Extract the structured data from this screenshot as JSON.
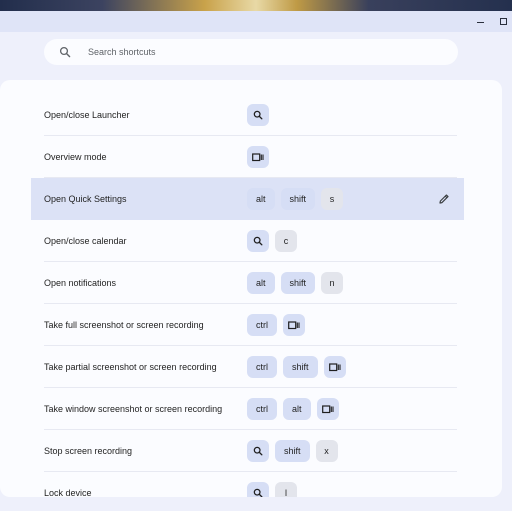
{
  "colors": {
    "window_bg": "#eef0fb",
    "titlebar_bg": "#dfe4f7",
    "panel_bg": "#fbfcff",
    "selected_row_bg": "#dce2f6",
    "key_bg": "#d6def5",
    "char_key_bg": "#e3e5ec"
  },
  "search": {
    "placeholder": "Search shortcuts",
    "icon": "search-icon"
  },
  "window_controls": [
    {
      "name": "minimize",
      "icon": "minimize-icon"
    },
    {
      "name": "maximize",
      "icon": "maximize-icon"
    }
  ],
  "shortcuts": [
    {
      "description": "Open/close Launcher",
      "keys": [
        {
          "type": "icon",
          "icon": "search"
        }
      ]
    },
    {
      "description": "Overview mode",
      "keys": [
        {
          "type": "icon",
          "icon": "overview"
        }
      ]
    },
    {
      "description": "Open Quick Settings",
      "selected": true,
      "edit_icon": "pencil-icon",
      "keys": [
        {
          "type": "mod",
          "label": "alt"
        },
        {
          "type": "mod",
          "label": "shift"
        },
        {
          "type": "text",
          "label": "s"
        }
      ]
    },
    {
      "description": "Open/close calendar",
      "keys": [
        {
          "type": "icon",
          "icon": "search"
        },
        {
          "type": "text",
          "label": "c"
        }
      ]
    },
    {
      "description": "Open notifications",
      "keys": [
        {
          "type": "mod",
          "label": "alt"
        },
        {
          "type": "mod",
          "label": "shift"
        },
        {
          "type": "text",
          "label": "n"
        }
      ]
    },
    {
      "description": "Take full screenshot or screen recording",
      "keys": [
        {
          "type": "mod",
          "label": "ctrl"
        },
        {
          "type": "icon",
          "icon": "overview"
        }
      ]
    },
    {
      "description": "Take partial screenshot or screen recording",
      "keys": [
        {
          "type": "mod",
          "label": "ctrl"
        },
        {
          "type": "mod",
          "label": "shift"
        },
        {
          "type": "icon",
          "icon": "overview"
        }
      ]
    },
    {
      "description": "Take window screenshot or screen recording",
      "keys": [
        {
          "type": "mod",
          "label": "ctrl"
        },
        {
          "type": "mod",
          "label": "alt"
        },
        {
          "type": "icon",
          "icon": "overview"
        }
      ]
    },
    {
      "description": "Stop screen recording",
      "keys": [
        {
          "type": "icon",
          "icon": "search"
        },
        {
          "type": "mod",
          "label": "shift"
        },
        {
          "type": "text",
          "label": "x"
        }
      ]
    },
    {
      "description": "Lock device",
      "keys": [
        {
          "type": "icon",
          "icon": "search"
        },
        {
          "type": "text",
          "label": "l"
        }
      ]
    }
  ]
}
